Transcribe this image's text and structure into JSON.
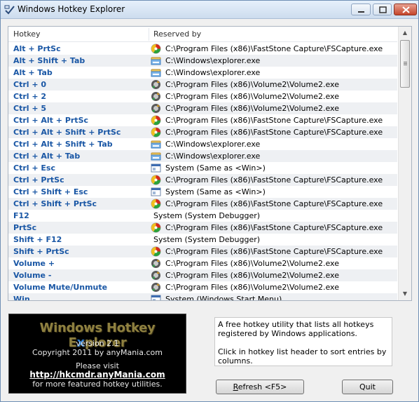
{
  "window": {
    "title": "Windows Hotkey Explorer",
    "controls": {
      "minimize": "minimize",
      "maximize": "maximize",
      "close": "close"
    }
  },
  "table": {
    "columns": [
      "Hotkey",
      "Reserved by"
    ],
    "rows": [
      {
        "hotkey": "Alt + PrtSc",
        "icon": "fscapture-icon",
        "reserved_by": "C:\\Program Files (x86)\\FastStone Capture\\FSCapture.exe"
      },
      {
        "hotkey": "Alt + Shift + Tab",
        "icon": "explorer-icon",
        "reserved_by": "C:\\Windows\\explorer.exe"
      },
      {
        "hotkey": "Alt + Tab",
        "icon": "explorer-icon",
        "reserved_by": "C:\\Windows\\explorer.exe"
      },
      {
        "hotkey": "Ctrl + 0",
        "icon": "volume2-icon",
        "reserved_by": "C:\\Program Files (x86)\\Volume2\\Volume2.exe"
      },
      {
        "hotkey": "Ctrl + 2",
        "icon": "volume2-icon",
        "reserved_by": "C:\\Program Files (x86)\\Volume2\\Volume2.exe"
      },
      {
        "hotkey": "Ctrl + 5",
        "icon": "volume2-icon",
        "reserved_by": "C:\\Program Files (x86)\\Volume2\\Volume2.exe"
      },
      {
        "hotkey": "Ctrl + Alt + PrtSc",
        "icon": "fscapture-icon",
        "reserved_by": "C:\\Program Files (x86)\\FastStone Capture\\FSCapture.exe"
      },
      {
        "hotkey": "Ctrl + Alt + Shift + PrtSc",
        "icon": "fscapture-icon",
        "reserved_by": "C:\\Program Files (x86)\\FastStone Capture\\FSCapture.exe"
      },
      {
        "hotkey": "Ctrl + Alt + Shift + Tab",
        "icon": "explorer-icon",
        "reserved_by": "C:\\Windows\\explorer.exe"
      },
      {
        "hotkey": "Ctrl + Alt + Tab",
        "icon": "explorer-icon",
        "reserved_by": "C:\\Windows\\explorer.exe"
      },
      {
        "hotkey": "Ctrl + Esc",
        "icon": "system-icon",
        "reserved_by": "System (Same as <Win>)"
      },
      {
        "hotkey": "Ctrl + PrtSc",
        "icon": "fscapture-icon",
        "reserved_by": "C:\\Program Files (x86)\\FastStone Capture\\FSCapture.exe"
      },
      {
        "hotkey": "Ctrl + Shift + Esc",
        "icon": "system-icon",
        "reserved_by": "System (Same as <Win>)"
      },
      {
        "hotkey": "Ctrl + Shift + PrtSc",
        "icon": "fscapture-icon",
        "reserved_by": "C:\\Program Files (x86)\\FastStone Capture\\FSCapture.exe"
      },
      {
        "hotkey": "F12",
        "icon": "",
        "reserved_by": "System (System Debugger)"
      },
      {
        "hotkey": "PrtSc",
        "icon": "fscapture-icon",
        "reserved_by": "C:\\Program Files (x86)\\FastStone Capture\\FSCapture.exe"
      },
      {
        "hotkey": "Shift + F12",
        "icon": "",
        "reserved_by": "System (System Debugger)"
      },
      {
        "hotkey": "Shift + PrtSc",
        "icon": "fscapture-icon",
        "reserved_by": "C:\\Program Files (x86)\\FastStone Capture\\FSCapture.exe"
      },
      {
        "hotkey": "Volume +",
        "icon": "volume2-icon",
        "reserved_by": "C:\\Program Files (x86)\\Volume2\\Volume2.exe"
      },
      {
        "hotkey": "Volume -",
        "icon": "volume2-icon",
        "reserved_by": "C:\\Program Files (x86)\\Volume2\\Volume2.exe"
      },
      {
        "hotkey": "Volume Mute/Unmute",
        "icon": "volume2-icon",
        "reserved_by": "C:\\Program Files (x86)\\Volume2\\Volume2.exe"
      },
      {
        "hotkey": "Win",
        "icon": "system-icon",
        "reserved_by": "System (Windows Start Menu)"
      }
    ]
  },
  "banner": {
    "title_part1": "Windows Hotkey E",
    "title_part2": "x",
    "title_part3": "plorer",
    "version": "version 2.1",
    "copyright": "Copyright 2011 by anyMania.com",
    "visit": "Please visit",
    "link": "http://hkcmdr.anyMania.com",
    "more": "for more featured hotkey utilities."
  },
  "description": {
    "line1": "A free hotkey utility that lists all hotkeys registered by Windows applications.",
    "line2": "Click in hotkey list header to sort entries by columns."
  },
  "buttons": {
    "refresh_r": "R",
    "refresh_rest": "efresh <F5>",
    "quit": "Quit"
  },
  "colors": {
    "hotkey_text": "#1a57a5",
    "alt_row": "#eef0f3",
    "banner_bg": "#000000"
  }
}
